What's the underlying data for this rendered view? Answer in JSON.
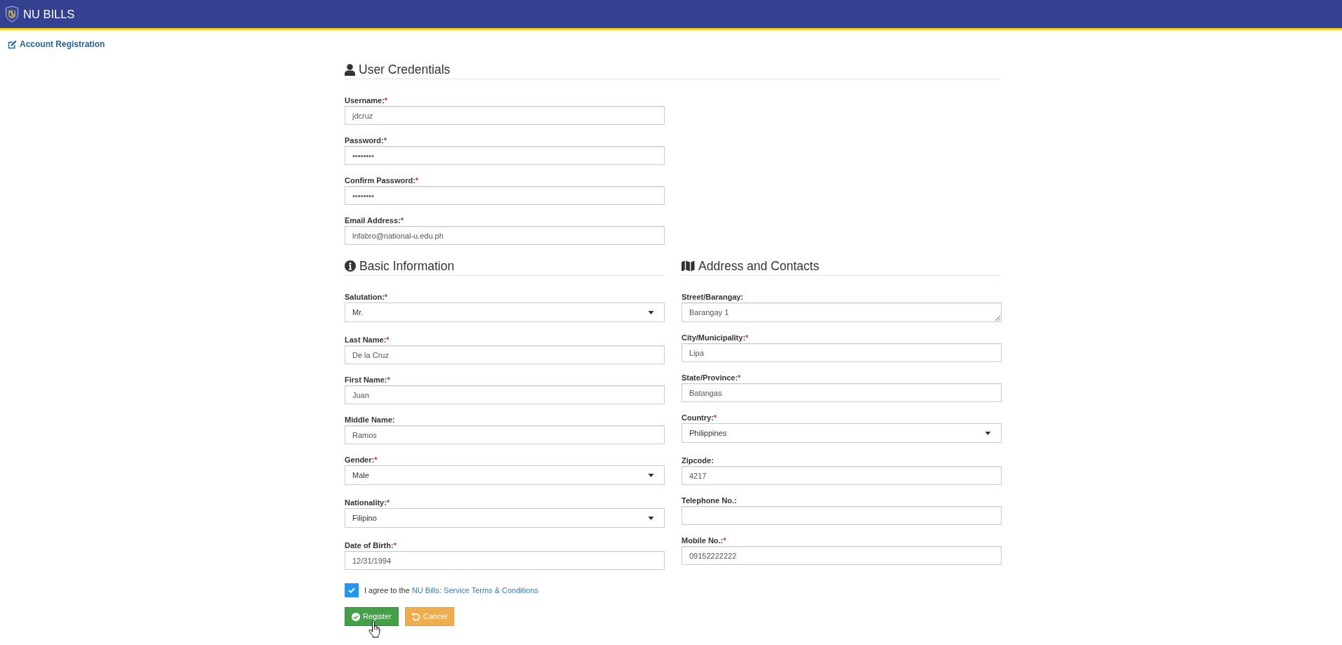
{
  "navbar": {
    "brand": "NU BILLS"
  },
  "page_title": "Account Registration",
  "credentials": {
    "title": "User Credentials",
    "fields": [
      {
        "label": "Username:",
        "required_mark": "*",
        "kind": "text",
        "value": "jdcruz"
      },
      {
        "label": "Password:",
        "required_mark": "*",
        "kind": "password",
        "value": "••••••••"
      },
      {
        "label": "Confirm Password:",
        "required_mark": "*",
        "kind": "password",
        "value": "••••••••"
      },
      {
        "label": "Email Address:",
        "required_mark": "*",
        "kind": "text",
        "value": "lnfabro@national-u.edu.ph"
      }
    ]
  },
  "basic_information": {
    "title": "Basic Information",
    "fields": [
      {
        "label": "Salutation:",
        "required_mark": "*",
        "kind": "select",
        "value": "Mr."
      },
      {
        "label": "Last Name:",
        "required_mark": "*",
        "kind": "text",
        "value": "De la Cruz"
      },
      {
        "label": "First Name:",
        "required_mark": "*",
        "kind": "text",
        "value": "Juan"
      },
      {
        "label": "Middle Name:",
        "kind": "text",
        "value": "Ramos"
      },
      {
        "label": "Gender:",
        "required_mark": "*",
        "kind": "select",
        "value": "Male"
      },
      {
        "label": "Nationality:",
        "required_mark": "*",
        "kind": "select",
        "value": "Filipino"
      },
      {
        "label": "Date of Birth:",
        "required_mark": "*",
        "kind": "text",
        "value": "12/31/1994"
      }
    ]
  },
  "address_and_contacts": {
    "title": "Address and Contacts",
    "fields": [
      {
        "label": "Street/Barangay:",
        "kind": "textarea",
        "value": "Barangay 1"
      },
      {
        "label": "City/Municipality:",
        "required_mark": "*",
        "kind": "text",
        "value": "Lipa"
      },
      {
        "label": "State/Province:",
        "required_mark": "*",
        "kind": "text",
        "value": "Batangas"
      },
      {
        "label": "Country:",
        "required_mark": "*",
        "kind": "select",
        "value": "Philippines"
      },
      {
        "label": "Zipcode:",
        "kind": "text",
        "value": "4217"
      },
      {
        "label": "Telephone No.:",
        "kind": "text"
      },
      {
        "label": "Mobile No.:",
        "required_mark": "*",
        "kind": "text",
        "value": "09152222222"
      }
    ]
  },
  "agreement": {
    "checked": true,
    "text": "I agree to the",
    "link": "NU Bills: Service Terms & Conditions"
  },
  "buttons": [
    {
      "label": "Register",
      "kind": "submit"
    },
    {
      "label": "Cancel",
      "kind": "cancel"
    }
  ]
}
